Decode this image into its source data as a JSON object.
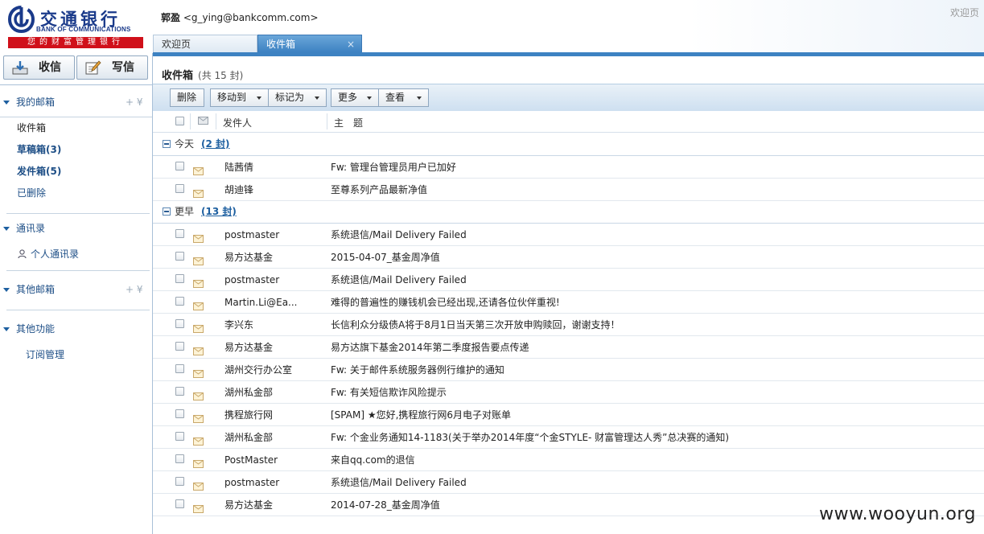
{
  "header": {
    "logo_cn": "交通银行",
    "logo_en": "BANK OF COMMUNICATIONS",
    "slogan": "您的财富管理银行",
    "user_name": "郭盈",
    "user_email": "<g_ying@bankcomm.com>",
    "welcome_link": "欢迎页"
  },
  "tabs": [
    {
      "label": "欢迎页"
    },
    {
      "label": "收件箱",
      "close": "×"
    }
  ],
  "sidebar": {
    "receive_label": "收信",
    "compose_label": "写信",
    "my_mailbox": {
      "label": "我的邮箱",
      "actions": "+ ¥",
      "items": [
        {
          "label": "收件箱"
        },
        {
          "label": "草稿箱(3)"
        },
        {
          "label": "发件箱(5)"
        },
        {
          "label": "已删除"
        }
      ]
    },
    "contacts": {
      "label": "通讯录",
      "items": [
        {
          "label": "个人通讯录"
        }
      ]
    },
    "other_mailbox": {
      "label": "其他邮箱",
      "actions": "+ ¥"
    },
    "other_functions": {
      "label": "其他功能",
      "items": [
        {
          "label": "订阅管理"
        }
      ]
    }
  },
  "main": {
    "title": "收件箱",
    "count": "(共 15 封)",
    "toolbar": {
      "delete": "删除",
      "move_to": "移动到",
      "mark_as": "标记为",
      "more": "更多",
      "view": "查看"
    },
    "columns": {
      "sender": "发件人",
      "subject": "主　题"
    },
    "groups": [
      {
        "label": "今天",
        "count": "(2 封)",
        "mails": [
          {
            "from": "陆茜倩",
            "subject": "Fw: 管理台管理员用户已加好"
          },
          {
            "from": "胡迪锋",
            "subject": "至尊系列产品最新净值"
          }
        ]
      },
      {
        "label": "更早",
        "count": "(13 封)",
        "mails": [
          {
            "from": "postmaster",
            "subject": "系统退信/Mail Delivery Failed"
          },
          {
            "from": "易方达基金",
            "subject": "2015-04-07_基金周净值"
          },
          {
            "from": "postmaster",
            "subject": "系统退信/Mail Delivery Failed"
          },
          {
            "from": "Martin.Li@Ea...",
            "subject": "难得的普遍性的赚钱机会已经出现,还请各位伙伴重视!"
          },
          {
            "from": "李兴东",
            "subject": "长信利众分级债A将于8月1日当天第三次开放申购赎回，谢谢支持！"
          },
          {
            "from": "易方达基金",
            "subject": "易方达旗下基金2014年第二季度报告要点传递"
          },
          {
            "from": "湖州交行办公室",
            "subject": "Fw: 关于邮件系统服务器例行维护的通知"
          },
          {
            "from": "湖州私金部",
            "subject": "Fw: 有关短信欺诈风险提示"
          },
          {
            "from": "携程旅行网",
            "subject": "[SPAM] ★您好,携程旅行网6月电子对账单"
          },
          {
            "from": "湖州私金部",
            "subject": "Fw: 个金业务通知14-1183(关于举办2014年度“个金STYLE- 财富管理达人秀”总决赛的通知)"
          },
          {
            "from": "PostMaster",
            "subject": "来自qq.com的退信"
          },
          {
            "from": "postmaster",
            "subject": "系统退信/Mail Delivery Failed"
          },
          {
            "from": "易方达基金",
            "subject": "2014-07-28_基金周净值"
          }
        ]
      }
    ]
  },
  "watermark": "www.wooyun.org"
}
